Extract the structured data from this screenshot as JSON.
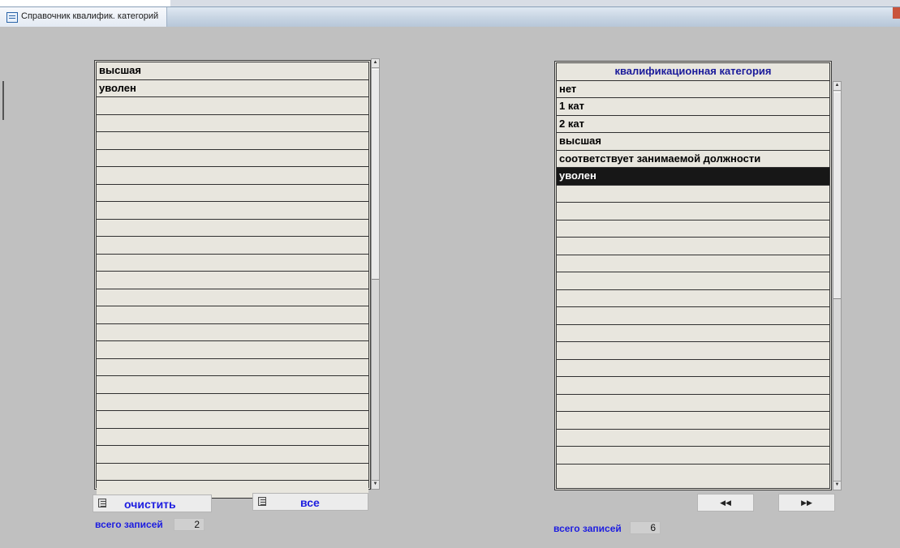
{
  "window": {
    "title": "Справочник квалифик. категорий"
  },
  "left_list": {
    "rows": [
      "высшая",
      "уволен",
      "",
      "",
      "",
      "",
      "",
      "",
      "",
      "",
      "",
      "",
      "",
      "",
      "",
      "",
      "",
      "",
      "",
      "",
      "",
      "",
      "",
      "",
      ""
    ]
  },
  "left_buttons": {
    "clear_label": "очистить",
    "all_label": "все"
  },
  "left_count": {
    "label": "всего записей",
    "value": "2"
  },
  "right_list": {
    "header": "квалификационная категория",
    "rows": [
      "нет",
      "1 кат",
      "2 кат",
      "высшая",
      "соответствует занимаемой должности",
      "уволен",
      "",
      "",
      "",
      "",
      "",
      "",
      "",
      "",
      "",
      "",
      "",
      "",
      "",
      "",
      "",
      ""
    ],
    "selected_index": 5
  },
  "right_nav": {
    "first_icon": "first-record-icon",
    "last_icon": "last-record-icon",
    "first_glyph": "◀◀",
    "last_glyph": "▶▶"
  },
  "right_count": {
    "label": "всего записей",
    "value": "6"
  }
}
